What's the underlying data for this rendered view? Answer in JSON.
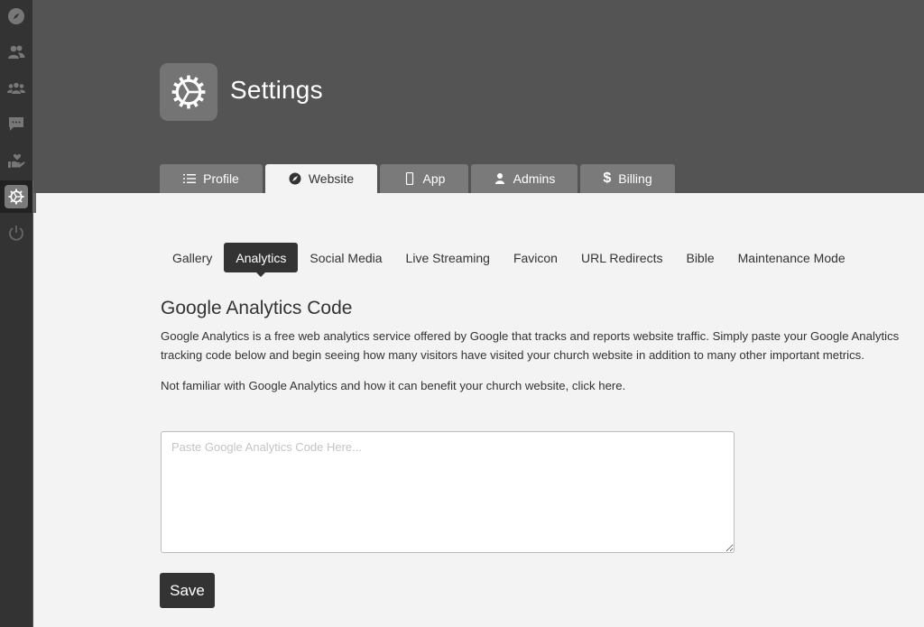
{
  "sidebar": {
    "items": [
      {
        "icon": "compass-icon",
        "label": "Website"
      },
      {
        "icon": "users-icon",
        "label": "People"
      },
      {
        "icon": "groups-icon",
        "label": "Groups"
      },
      {
        "icon": "chat-icon",
        "label": "Messages"
      },
      {
        "icon": "giving-icon",
        "label": "Giving"
      },
      {
        "icon": "gear-icon",
        "label": "Settings",
        "active": true
      },
      {
        "icon": "power-icon",
        "label": "Log Out"
      }
    ]
  },
  "header": {
    "title": "Settings",
    "icon": "gear-icon"
  },
  "tabs": [
    {
      "label": "Profile",
      "icon": "list-icon"
    },
    {
      "label": "Website",
      "icon": "compass-icon",
      "active": true
    },
    {
      "label": "App",
      "icon": "mobile-icon"
    },
    {
      "label": "Admins",
      "icon": "user-icon"
    },
    {
      "label": "Billing",
      "icon": "dollar-icon"
    }
  ],
  "subnav": [
    {
      "label": "Gallery"
    },
    {
      "label": "Analytics",
      "active": true
    },
    {
      "label": "Social Media"
    },
    {
      "label": "Live Streaming"
    },
    {
      "label": "Favicon"
    },
    {
      "label": "URL Redirects"
    },
    {
      "label": "Bible"
    },
    {
      "label": "Maintenance Mode"
    }
  ],
  "main": {
    "section_title": "Google Analytics Code",
    "description": "Google Analytics is a free web analytics service offered by Google that tracks and reports website traffic. Simply paste your Google Analytics tracking code below and begin seeing how many visitors have visited your church website in addition to many other important metrics.",
    "help_text": "Not familiar with Google Analytics and how it can benefit your church website, click here.",
    "code_input": {
      "value": "",
      "placeholder": "Paste Google Analytics Code Here..."
    },
    "save_label": "Save"
  },
  "colors": {
    "sidebar_bg": "#333333",
    "header_bg": "#545454",
    "tab_bg": "#7a7a7a",
    "content_bg": "#f3f3f3",
    "accent_dark": "#333333"
  }
}
